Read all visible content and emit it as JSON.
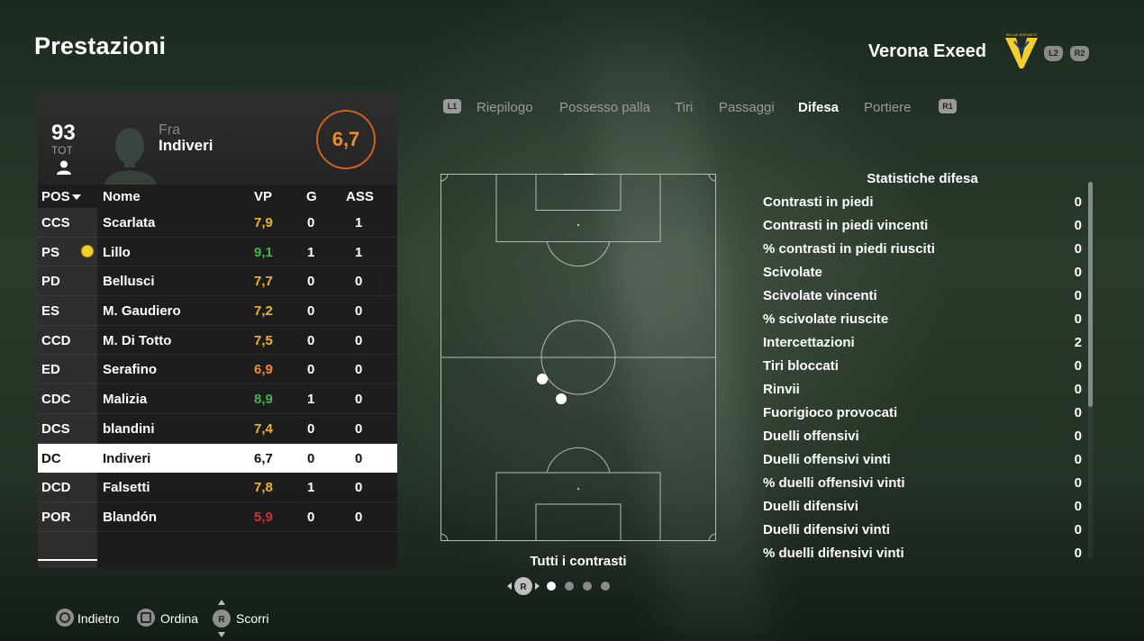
{
  "title": "Prestazioni",
  "team": {
    "name": "Verona Exeed",
    "logo_text": "HELLAS VERONA FC",
    "btn_left": "L2",
    "btn_right": "R2"
  },
  "player": {
    "ovr": "93",
    "ovr_label": "TOT",
    "first_name": "Fra",
    "last_name": "Indiveri",
    "rating": "6,7"
  },
  "table": {
    "headers": {
      "pos": "POS",
      "name": "Nome",
      "vp": "VP",
      "g": "G",
      "ass": "ASS"
    },
    "rows": [
      {
        "pos": "CCS",
        "name": "Scarlata",
        "vp": "7,9",
        "g": "0",
        "ass": "1",
        "vp_color": "#f0b429",
        "ball": false
      },
      {
        "pos": "PS",
        "name": "Lillo",
        "vp": "9,1",
        "g": "1",
        "ass": "1",
        "vp_color": "#43b649",
        "ball": true
      },
      {
        "pos": "PD",
        "name": "Bellusci",
        "vp": "7,7",
        "g": "0",
        "ass": "0",
        "vp_color": "#f0b429",
        "ball": false
      },
      {
        "pos": "ES",
        "name": "M. Gaudiero",
        "vp": "7,2",
        "g": "0",
        "ass": "0",
        "vp_color": "#f0b429",
        "ball": false
      },
      {
        "pos": "CCD",
        "name": "M. Di Totto",
        "vp": "7,5",
        "g": "0",
        "ass": "0",
        "vp_color": "#f0b429",
        "ball": false
      },
      {
        "pos": "ED",
        "name": "Serafino",
        "vp": "6,9",
        "g": "0",
        "ass": "0",
        "vp_color": "#f08a2c",
        "ball": false
      },
      {
        "pos": "CDC",
        "name": "Malizia",
        "vp": "8,9",
        "g": "1",
        "ass": "0",
        "vp_color": "#43b649",
        "ball": false
      },
      {
        "pos": "DCS",
        "name": "blandini",
        "vp": "7,4",
        "g": "0",
        "ass": "0",
        "vp_color": "#f0b429",
        "ball": false
      },
      {
        "pos": "DC",
        "name": "Indiveri",
        "vp": "6,7",
        "g": "0",
        "ass": "0",
        "vp_color": "#111111",
        "ball": false,
        "selected": true
      },
      {
        "pos": "DCD",
        "name": "Falsetti",
        "vp": "7,8",
        "g": "1",
        "ass": "0",
        "vp_color": "#f0b429",
        "ball": false
      },
      {
        "pos": "POR",
        "name": "Blandón",
        "vp": "5,9",
        "g": "0",
        "ass": "0",
        "vp_color": "#d0303a",
        "ball": false
      }
    ]
  },
  "tabs": {
    "left_btn": "L1",
    "right_btn": "R1",
    "items": [
      "Riepilogo",
      "Possesso palla",
      "Tiri",
      "Passaggi",
      "Difesa",
      "Portiere"
    ],
    "active": "Difesa"
  },
  "pitch": {
    "caption": "Tutti i contrasti",
    "pager_btn": "R"
  },
  "stats": {
    "title": "Statistiche difesa",
    "rows": [
      {
        "label": "Contrasti in piedi",
        "value": "0"
      },
      {
        "label": "Contrasti in piedi vincenti",
        "value": "0"
      },
      {
        "label": "% contrasti in piedi riusciti",
        "value": "0"
      },
      {
        "label": "Scivolate",
        "value": "0"
      },
      {
        "label": "Scivolate vincenti",
        "value": "0"
      },
      {
        "label": "% scivolate riuscite",
        "value": "0"
      },
      {
        "label": "Intercettazioni",
        "value": "2"
      },
      {
        "label": "Tiri bloccati",
        "value": "0"
      },
      {
        "label": "Rinvii",
        "value": "0"
      },
      {
        "label": "Fuorigioco provocati",
        "value": "0"
      },
      {
        "label": "Duelli offensivi",
        "value": "0"
      },
      {
        "label": "Duelli offensivi vinti",
        "value": "0"
      },
      {
        "label": "% duelli offensivi vinti",
        "value": "0"
      },
      {
        "label": "Duelli difensivi",
        "value": "0"
      },
      {
        "label": "Duelli difensivi vinti",
        "value": "0"
      },
      {
        "label": "% duelli difensivi vinti",
        "value": "0"
      }
    ]
  },
  "footer": {
    "back": "Indietro",
    "sort": "Ordina",
    "scroll": "Scorri",
    "scroll_btn": "R"
  }
}
